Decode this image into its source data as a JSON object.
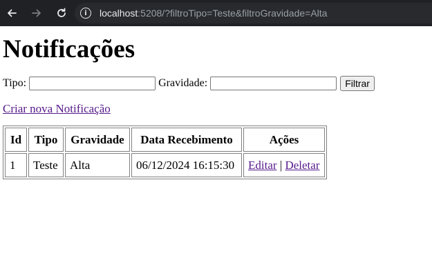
{
  "browser": {
    "url_host": "localhost",
    "url_rest": ":5208/?filtroTipo=Teste&filtroGravidade=Alta"
  },
  "page": {
    "title": "Notificações",
    "filter": {
      "tipo_label": "Tipo:",
      "tipo_value": "",
      "gravidade_label": "Gravidade:",
      "gravidade_value": "",
      "submit_label": "Filtrar"
    },
    "create_link": "Criar nova Notificação",
    "table": {
      "headers": [
        "Id",
        "Tipo",
        "Gravidade",
        "Data Recebimento",
        "Ações"
      ],
      "rows": [
        {
          "id": "1",
          "tipo": "Teste",
          "gravidade": "Alta",
          "data": "06/12/2024 16:15:30",
          "edit_label": "Editar",
          "separator": "|",
          "delete_label": "Deletar"
        }
      ]
    }
  }
}
